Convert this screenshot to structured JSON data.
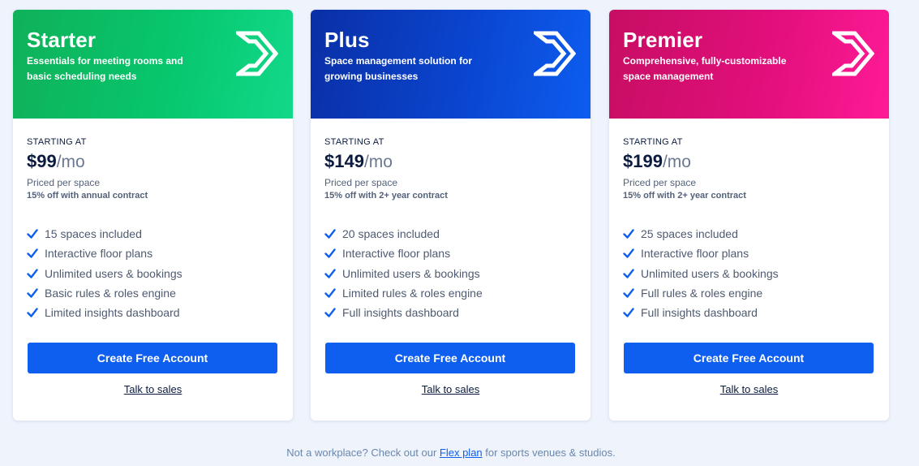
{
  "plans": [
    {
      "name": "Starter",
      "description": "Essentials for meeting rooms and basic scheduling needs",
      "starting_label": "STARTING AT",
      "price": "$99",
      "unit": "/mo",
      "priced_per": "Priced per space",
      "discount": "15% off with annual contract",
      "features": [
        "15 spaces included",
        "Interactive floor plans",
        "Unlimited users & bookings",
        "Basic rules & roles engine",
        "Limited insights dashboard"
      ],
      "cta_label": "Create Free Account",
      "sales_label": "Talk to sales",
      "header_color": "#07c66c"
    },
    {
      "name": "Plus",
      "description": "Space management solution for growing businesses",
      "starting_label": "STARTING AT",
      "price": "$149",
      "unit": "/mo",
      "priced_per": "Priced per space",
      "discount": "15% off with 2+ year contract",
      "features": [
        "20 spaces included",
        "Interactive floor plans",
        "Unlimited users & bookings",
        "Limited rules & roles engine",
        "Full insights dashboard"
      ],
      "cta_label": "Create Free Account",
      "sales_label": "Talk to sales",
      "header_color": "#0a45cf"
    },
    {
      "name": "Premier",
      "description": "Comprehensive, fully-customizable space management",
      "starting_label": "STARTING AT",
      "price": "$199",
      "unit": "/mo",
      "priced_per": "Priced per space",
      "discount": "15% off with 2+ year contract",
      "features": [
        "25 spaces included",
        "Interactive floor plans",
        "Unlimited users & bookings",
        "Full rules & roles engine",
        "Full insights dashboard"
      ],
      "cta_label": "Create Free Account",
      "sales_label": "Talk to sales",
      "header_color": "#e10f7b"
    }
  ],
  "footer": {
    "prefix": "Not a workplace? Check out our ",
    "link": "Flex plan",
    "suffix": " for sports venues & studios."
  },
  "colors": {
    "accent": "#0e5ff0",
    "check": "#0e5ff0",
    "page_background": "#eef3fc"
  },
  "icons": {
    "logo": "brand-logo-icon",
    "check": "check-icon"
  }
}
